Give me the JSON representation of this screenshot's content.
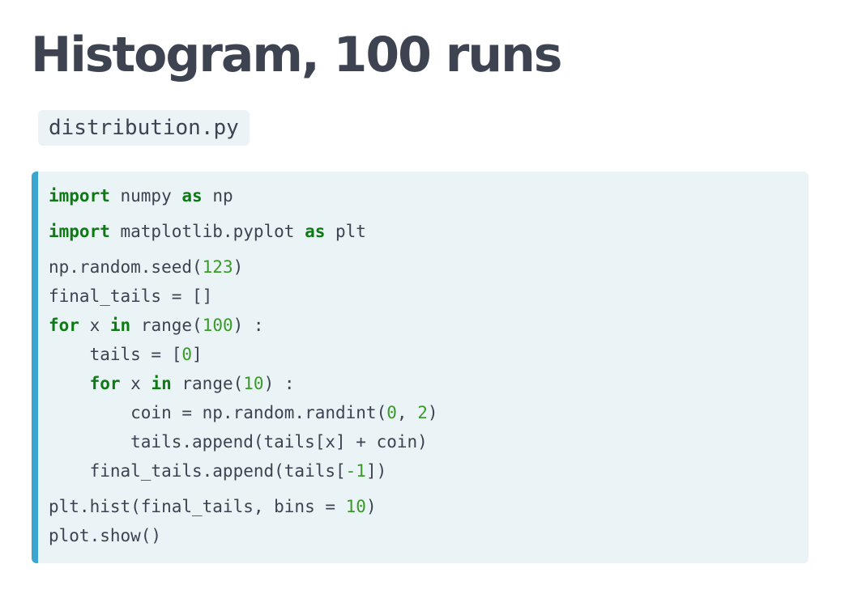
{
  "title": "Histogram, 100 runs",
  "filename": "distribution.py",
  "code": {
    "lines": [
      {
        "tokens": [
          {
            "t": "import",
            "k": "kw"
          },
          {
            "t": " numpy ",
            "k": "plain"
          },
          {
            "t": "as",
            "k": "kw"
          },
          {
            "t": " np",
            "k": "plain"
          }
        ]
      },
      {
        "tokens": [
          {
            "t": "import",
            "k": "kw"
          },
          {
            "t": " matplotlib.pyplot ",
            "k": "plain"
          },
          {
            "t": "as",
            "k": "kw"
          },
          {
            "t": " plt",
            "k": "plain"
          }
        ]
      },
      {
        "tokens": [
          {
            "t": "np.random.seed(",
            "k": "plain"
          },
          {
            "t": "123",
            "k": "num"
          },
          {
            "t": ")",
            "k": "plain"
          }
        ]
      },
      {
        "tokens": [
          {
            "t": "final_tails = []",
            "k": "plain"
          }
        ]
      },
      {
        "tokens": [
          {
            "t": "for",
            "k": "kw"
          },
          {
            "t": " x ",
            "k": "plain"
          },
          {
            "t": "in",
            "k": "kw"
          },
          {
            "t": " range(",
            "k": "plain"
          },
          {
            "t": "100",
            "k": "num"
          },
          {
            "t": ") :",
            "k": "plain"
          }
        ]
      },
      {
        "tokens": [
          {
            "t": "    tails = [",
            "k": "plain"
          },
          {
            "t": "0",
            "k": "num"
          },
          {
            "t": "]",
            "k": "plain"
          }
        ]
      },
      {
        "tokens": [
          {
            "t": "    ",
            "k": "plain"
          },
          {
            "t": "for",
            "k": "kw"
          },
          {
            "t": " x ",
            "k": "plain"
          },
          {
            "t": "in",
            "k": "kw"
          },
          {
            "t": " range(",
            "k": "plain"
          },
          {
            "t": "10",
            "k": "num"
          },
          {
            "t": ") :",
            "k": "plain"
          }
        ]
      },
      {
        "tokens": [
          {
            "t": "        coin = np.random.randint(",
            "k": "plain"
          },
          {
            "t": "0",
            "k": "num"
          },
          {
            "t": ", ",
            "k": "plain"
          },
          {
            "t": "2",
            "k": "num"
          },
          {
            "t": ")",
            "k": "plain"
          }
        ]
      },
      {
        "tokens": [
          {
            "t": "        tails.append(tails[x] + coin)",
            "k": "plain"
          }
        ]
      },
      {
        "tokens": [
          {
            "t": "    final_tails.append(tails[",
            "k": "plain"
          },
          {
            "t": "-1",
            "k": "num"
          },
          {
            "t": "])",
            "k": "plain"
          }
        ]
      },
      {
        "tokens": [
          {
            "t": "plt.hist(final_tails, bins = ",
            "k": "plain"
          },
          {
            "t": "10",
            "k": "num"
          },
          {
            "t": ")",
            "k": "plain"
          }
        ]
      },
      {
        "tokens": [
          {
            "t": "plot.show()",
            "k": "plain"
          }
        ]
      }
    ]
  },
  "colors": {
    "keyword": "#0e7a14",
    "number": "#3a9a2a",
    "text": "#3d4350",
    "accent_bar": "#3aa6cf",
    "code_background": "#eaf3f6"
  }
}
